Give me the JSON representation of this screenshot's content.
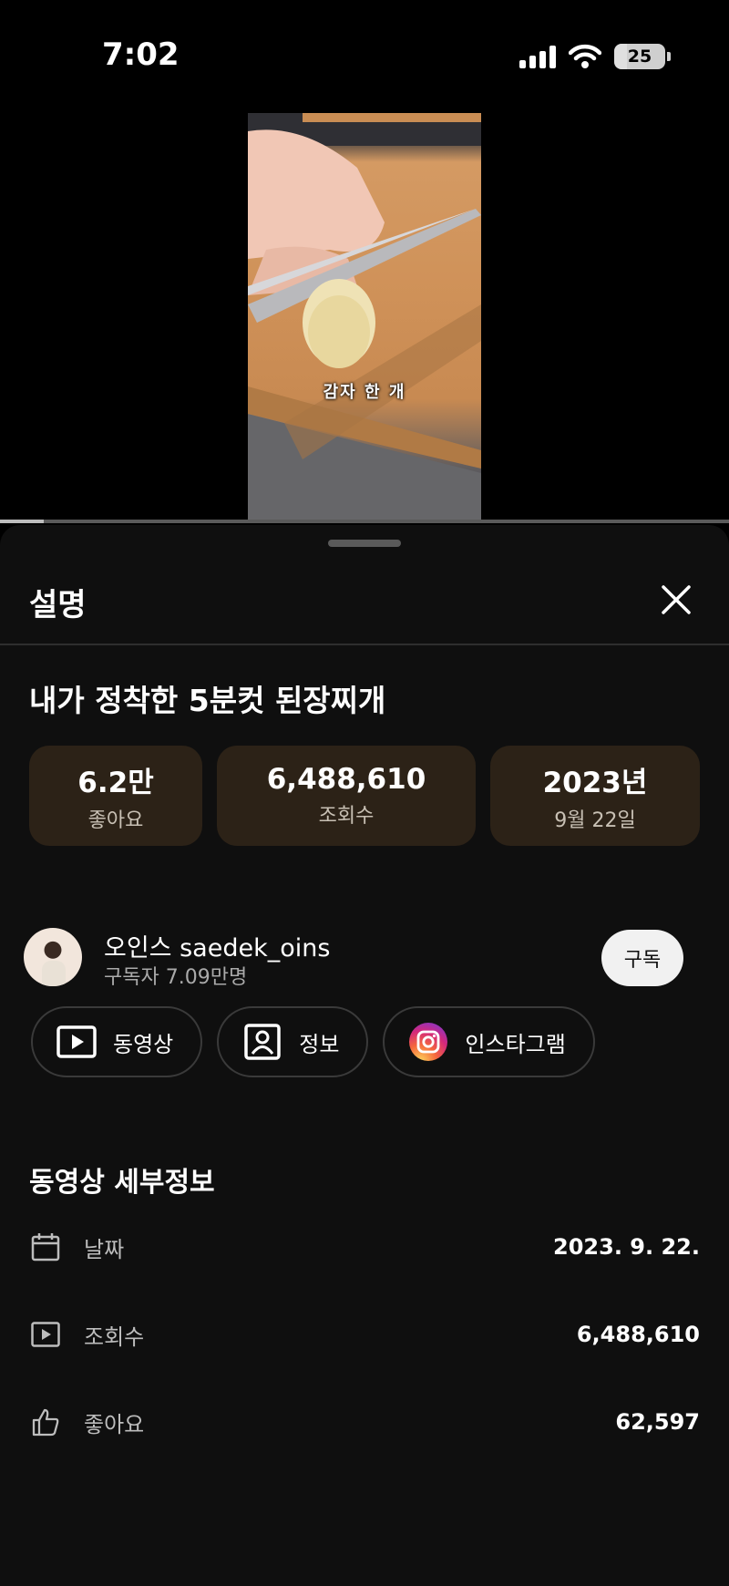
{
  "status": {
    "time": "7:02",
    "battery": "25"
  },
  "video": {
    "caption": "감자 한 개",
    "progress": 0.06
  },
  "sheet": {
    "header": "설명",
    "title": "내가 정착한 5분컷 된장찌개",
    "stats": [
      {
        "value": "6.2만",
        "label": "좋아요"
      },
      {
        "value": "6,488,610",
        "label": "조회수"
      },
      {
        "value": "2023년",
        "label": "9월 22일"
      }
    ],
    "channel": {
      "name": "오인스 saedek_oins",
      "subscribers": "구독자 7.09만명",
      "subscribe": "구독"
    },
    "chips": [
      {
        "label": "동영상",
        "icon": "video-play-icon"
      },
      {
        "label": "정보",
        "icon": "person-icon"
      },
      {
        "label": "인스타그램",
        "icon": "instagram-icon"
      }
    ],
    "details": {
      "heading": "동영상 세부정보",
      "rows": [
        {
          "icon": "calendar-icon",
          "label": "날짜",
          "value": "2023. 9. 22."
        },
        {
          "icon": "play-icon",
          "label": "조회수",
          "value": "6,488,610"
        },
        {
          "icon": "thumb-up-icon",
          "label": "좋아요",
          "value": "62,597"
        }
      ]
    }
  }
}
